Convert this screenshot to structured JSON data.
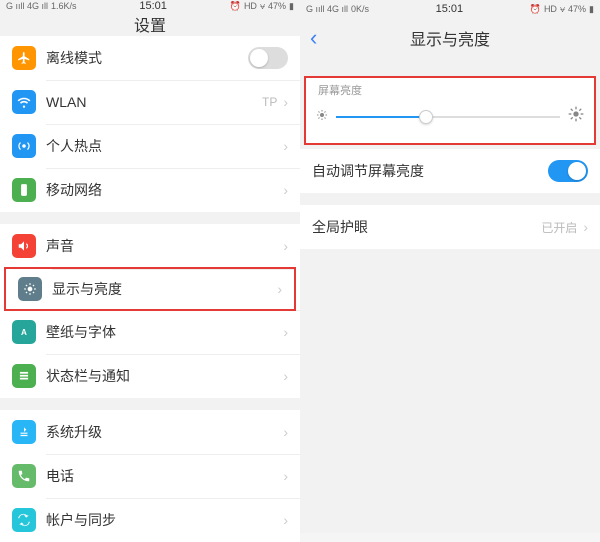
{
  "left": {
    "status": {
      "signal": "G ııll 4G ıll",
      "speed": "1.6K/s",
      "time": "15:01",
      "alarm": "⏰",
      "hd": "HD",
      "wifi": "⩝",
      "battery": "47%",
      "battIcon": "▮"
    },
    "title": "设置",
    "groups": [
      [
        {
          "icon": "plane",
          "color": "#ff9500",
          "label": "离线模式",
          "toggle": false
        },
        {
          "icon": "wifi",
          "color": "#2196f3",
          "label": "WLAN",
          "value": "TP"
        },
        {
          "icon": "hotspot",
          "color": "#2196f3",
          "label": "个人热点"
        },
        {
          "icon": "mobile",
          "color": "#4caf50",
          "label": "移动网络"
        }
      ],
      [
        {
          "icon": "sound",
          "color": "#f44336",
          "label": "声音"
        },
        {
          "icon": "brightness",
          "color": "#607d8b",
          "label": "显示与亮度",
          "highlight": true
        },
        {
          "icon": "wallpaper",
          "color": "#26a69a",
          "label": "壁纸与字体"
        },
        {
          "icon": "notify",
          "color": "#4caf50",
          "label": "状态栏与通知"
        }
      ],
      [
        {
          "icon": "update",
          "color": "#29b6f6",
          "label": "系统升级"
        },
        {
          "icon": "phone",
          "color": "#66bb6a",
          "label": "电话"
        },
        {
          "icon": "sync",
          "color": "#26c6da",
          "label": "帐户与同步"
        }
      ]
    ]
  },
  "right": {
    "status": {
      "signal": "G ııll 4G ıll",
      "speed": "0K/s",
      "time": "15:01",
      "alarm": "⏰",
      "hd": "HD",
      "wifi": "⩝",
      "battery": "47%",
      "battIcon": "▮"
    },
    "title": "显示与亮度",
    "brightness_section": "屏幕亮度",
    "slider_percent": 40,
    "auto_label": "自动调节屏幕亮度",
    "auto_on": true,
    "eye_label": "全局护眼",
    "eye_value": "已开启"
  }
}
